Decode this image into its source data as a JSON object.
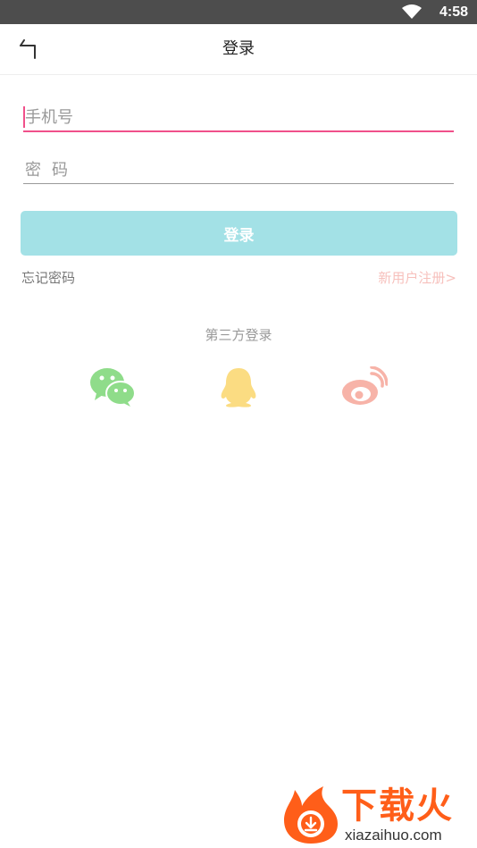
{
  "status_bar": {
    "time": "4:58"
  },
  "nav": {
    "title": "登录",
    "back_icon": "back-arrow-icon"
  },
  "form": {
    "phone_placeholder": "手机号",
    "phone_value": "",
    "password_placeholder": "密码",
    "password_value": "",
    "login_label": "登录"
  },
  "links": {
    "forgot": "忘记密码",
    "register": "新用户注册>"
  },
  "third_party": {
    "title": "第三方登录",
    "providers": [
      {
        "name": "wechat",
        "icon": "wechat-icon"
      },
      {
        "name": "qq",
        "icon": "qq-icon"
      },
      {
        "name": "weibo",
        "icon": "weibo-icon"
      }
    ]
  },
  "watermark": {
    "title": "下载火",
    "subtitle": "xiazaihuo.com"
  },
  "colors": {
    "status_bar": "#4d4d4d",
    "accent_pink": "#f0508a",
    "login_button": "#a3e1e6",
    "register_link": "#f7c0bc",
    "wechat": "#8fdc8a",
    "qq": "#fbdc82",
    "weibo": "#f7b3a8",
    "watermark_orange": "#ff5e19"
  }
}
